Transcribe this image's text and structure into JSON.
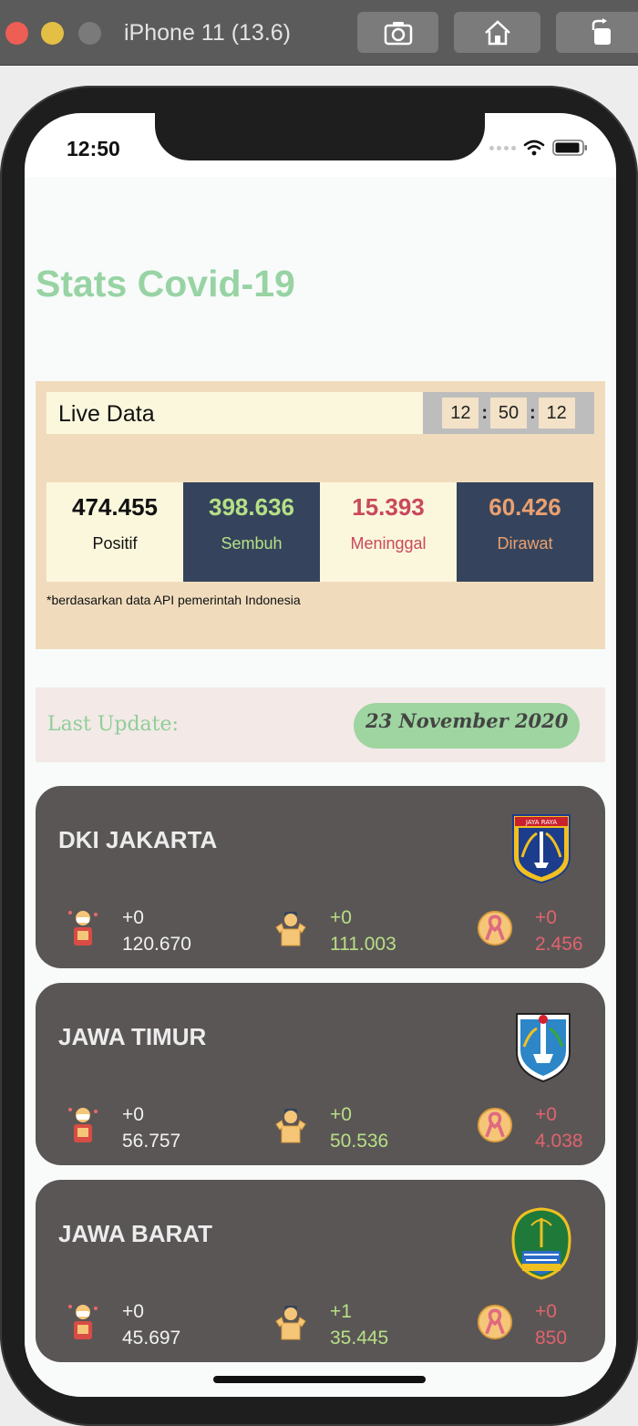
{
  "simulator": {
    "title": "iPhone 11 (13.6)",
    "buttons": [
      "camera-icon",
      "home-icon",
      "rotate-icon"
    ]
  },
  "status_bar": {
    "time": "12:50"
  },
  "app": {
    "title": "Stats Covid-19",
    "live": {
      "label": "Live Data",
      "clock": {
        "h": "12",
        "m": "50",
        "s": "12"
      }
    },
    "stats": {
      "positif": {
        "value": "474.455",
        "label": "Positif"
      },
      "sembuh": {
        "value": "398.636",
        "label": "Sembuh"
      },
      "meninggal": {
        "value": "15.393",
        "label": "Meninggal"
      },
      "dirawat": {
        "value": "60.426",
        "label": "Dirawat"
      }
    },
    "note": "*berdasarkan data API pemerintah Indonesia",
    "update": {
      "label": "Last Update:",
      "date": "23 November 2020"
    },
    "provinces": [
      {
        "name": "DKI JAKARTA",
        "positif": {
          "delta": "+0",
          "total": "120.670"
        },
        "sembuh": {
          "delta": "+0",
          "total": "111.003"
        },
        "meninggal": {
          "delta": "+0",
          "total": "2.456"
        }
      },
      {
        "name": "JAWA TIMUR",
        "positif": {
          "delta": "+0",
          "total": "56.757"
        },
        "sembuh": {
          "delta": "+0",
          "total": "50.536"
        },
        "meninggal": {
          "delta": "+0",
          "total": "4.038"
        }
      },
      {
        "name": "JAWA BARAT",
        "positif": {
          "delta": "+0",
          "total": "45.697"
        },
        "sembuh": {
          "delta": "+1",
          "total": "35.445"
        },
        "meninggal": {
          "delta": "+0",
          "total": "850"
        }
      }
    ]
  },
  "colors": {
    "title_green": "#98d3a4",
    "panel_beige": "#f0dcbd",
    "navy": "#35445c",
    "card_gray": "#5b5656",
    "recovered_green": "#b6e086",
    "death_red": "#c9485c"
  }
}
